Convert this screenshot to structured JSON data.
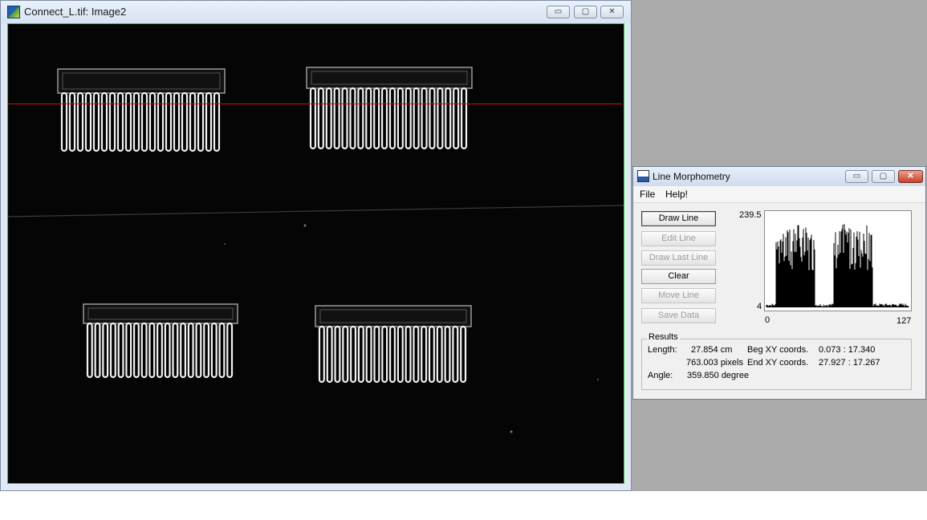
{
  "image_window": {
    "title": "Connect_L.tif: Image2",
    "controls": {
      "minimize": "▭",
      "maximize": "▢",
      "close": "✕"
    }
  },
  "dialog": {
    "title": "Line Morphometry",
    "menu": [
      "File",
      "Help!"
    ],
    "buttons": [
      {
        "label": "Draw Line",
        "enabled": true
      },
      {
        "label": "Edit Line",
        "enabled": false
      },
      {
        "label": "Draw Last Line",
        "enabled": false
      },
      {
        "label": "Clear",
        "enabled": true
      },
      {
        "label": "Move Line",
        "enabled": false
      },
      {
        "label": "Save Data",
        "enabled": false
      }
    ],
    "histogram": {
      "y_max": "239.5",
      "y_min": "4",
      "x_min": "0",
      "x_max": "127"
    },
    "results": {
      "legend": "Results",
      "length_label": "Length:",
      "length_cm": "27.854 cm",
      "length_pixels": "763.003 pixels",
      "angle_label": "Angle:",
      "angle_value": "359.850 degree",
      "beg_label": "Beg XY coords.",
      "beg_value": "0.073 : 17.340",
      "end_label": "End XY coords.",
      "end_value": "27.927 : 17.267"
    }
  },
  "colors": {
    "measure_line": "#cc1111",
    "frame_border": "#2ecc40",
    "desktop": "#ababab"
  }
}
